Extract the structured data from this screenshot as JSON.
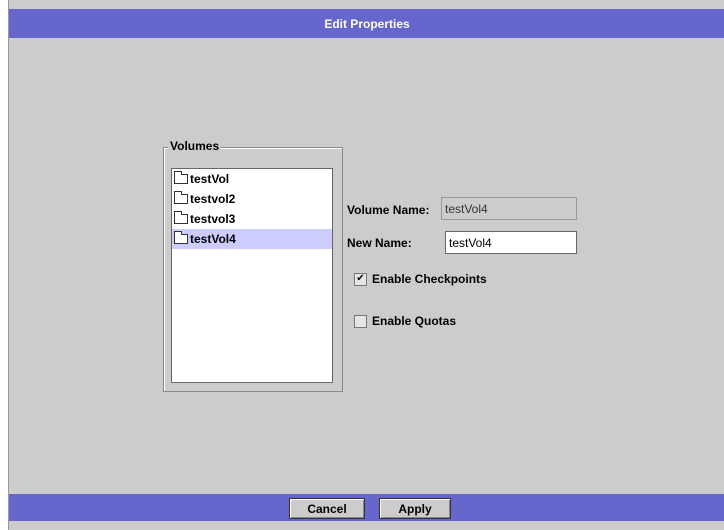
{
  "dialog": {
    "title": "Edit Properties"
  },
  "volumes": {
    "legend": "Volumes",
    "items": [
      {
        "label": "testVol",
        "selected": false
      },
      {
        "label": "testvol2",
        "selected": false
      },
      {
        "label": "testvol3",
        "selected": false
      },
      {
        "label": "testVol4",
        "selected": true
      }
    ]
  },
  "form": {
    "volume_name_label": "Volume Name:",
    "volume_name_value": "testVol4",
    "new_name_label": "New Name:",
    "new_name_value": "testVol4",
    "enable_checkpoints_label": "Enable Checkpoints",
    "enable_checkpoints_checked": true,
    "enable_quotas_label": "Enable Quotas",
    "enable_quotas_checked": false
  },
  "buttons": {
    "cancel_label": "Cancel",
    "apply_label": "Apply"
  },
  "colors": {
    "title_bar": "#6666cc",
    "background": "#cccccc",
    "selection": "#ccccff"
  }
}
